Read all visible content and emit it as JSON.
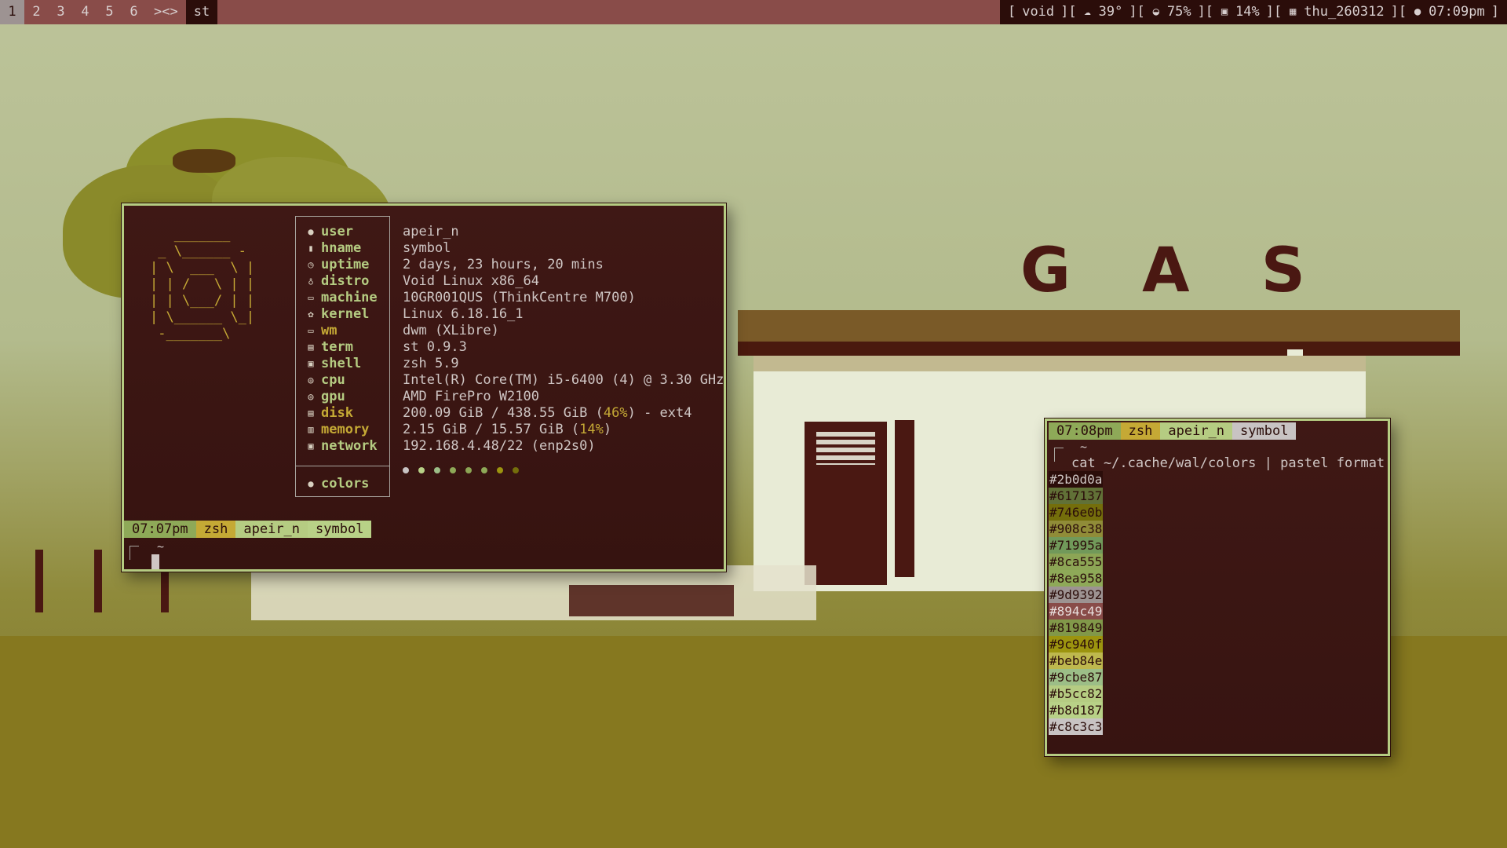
{
  "topbar": {
    "tags": [
      "1",
      "2",
      "3",
      "4",
      "5",
      "6"
    ],
    "active_tag": "1",
    "layout": "><>",
    "window_title": "st",
    "status": {
      "open": "[",
      "host": "void",
      "sep1": "][",
      "temp": "39°",
      "sep2": "][",
      "cpu_or_mem": "75%",
      "sep3": "][",
      "disk": "14%",
      "sep4": "][",
      "date": "thu_260312",
      "sep5": "][",
      "time": "07:09pm",
      "close": "]",
      "icons": [
        "cloud-sun-icon",
        "gauge-icon",
        "save-icon",
        "calendar-icon",
        "clock-icon"
      ]
    }
  },
  "fetch": {
    "logo": "   _______\n _ \\______ -\n| \\  ___  \\ |\n| | /   \\ | |\n| | \\___/ | |\n| \\______ \\_|\n -_______\\",
    "keys": [
      {
        "label": "user",
        "icon": "user-icon"
      },
      {
        "label": "hname",
        "icon": "phone-icon"
      },
      {
        "label": "uptime",
        "icon": "clock-icon"
      },
      {
        "label": "distro",
        "icon": "linux-icon"
      },
      {
        "label": "machine",
        "icon": "laptop-icon"
      },
      {
        "label": "kernel",
        "icon": "gear-icon"
      },
      {
        "label": "wm",
        "icon": "monitor-icon"
      },
      {
        "label": "term",
        "icon": "terminal-icon"
      },
      {
        "label": "shell",
        "icon": "shell-icon"
      },
      {
        "label": "cpu",
        "icon": "chip-icon"
      },
      {
        "label": "gpu",
        "icon": "chip-icon"
      },
      {
        "label": "disk",
        "icon": "disk-icon"
      },
      {
        "label": "memory",
        "icon": "memory-icon"
      },
      {
        "label": "network",
        "icon": "network-icon"
      }
    ],
    "colors_label": "colors",
    "values": {
      "user": "apeir_n",
      "hname": "symbol",
      "uptime": "2 days, 23 hours, 20 mins",
      "distro": "Void Linux x86_64",
      "machine": "10GR001QUS (ThinkCentre M700)",
      "kernel": "Linux 6.18.16_1",
      "wm": "dwm (XLibre)",
      "term": "st 0.9.3",
      "shell": "zsh 5.9",
      "cpu": "Intel(R) Core(TM) i5-6400 (4) @ 3.30 GHz",
      "gpu": "AMD FirePro W2100",
      "disk_a": "200.09 GiB / 438.55 GiB (",
      "disk_pct": "46%",
      "disk_b": ") - ext4",
      "mem_a": "2.15 GiB / 15.57 GiB (",
      "mem_pct": "14%",
      "mem_b": ")",
      "network": "192.168.4.48/22 (enp2s0)"
    },
    "dot_colors": [
      "#c8c3c3",
      "#b8d187",
      "#9cbe87",
      "#8ea958",
      "#8ca555",
      "#8ea958",
      "#9c940f",
      "#746e0b"
    ]
  },
  "prompt1": {
    "time": "07:07pm",
    "shell": "zsh",
    "user": "apeir_n",
    "host": "symbol",
    "dir": "~"
  },
  "prompt2": {
    "time": "07:08pm",
    "shell": "zsh",
    "user": "apeir_n",
    "host": "symbol",
    "dir": "~",
    "command": "cat ~/.cache/wal/colors | pastel format"
  },
  "swatches": [
    {
      "hex": "#2b0d0a",
      "bg": "#2b0d0a",
      "fg": "#cfc6c4"
    },
    {
      "hex": "#617137",
      "bg": "#617137",
      "fg": "#2b0d0a"
    },
    {
      "hex": "#746e0b",
      "bg": "#746e0b",
      "fg": "#2b0d0a"
    },
    {
      "hex": "#908c38",
      "bg": "#908c38",
      "fg": "#2b0d0a"
    },
    {
      "hex": "#71995a",
      "bg": "#71995a",
      "fg": "#2b0d0a"
    },
    {
      "hex": "#8ca555",
      "bg": "#8ca555",
      "fg": "#2b0d0a"
    },
    {
      "hex": "#8ea958",
      "bg": "#8ea958",
      "fg": "#2b0d0a"
    },
    {
      "hex": "#9d9392",
      "bg": "#9d9392",
      "fg": "#2b0d0a"
    },
    {
      "hex": "#894c49",
      "bg": "#894c49",
      "fg": "#e8dedd"
    },
    {
      "hex": "#819849",
      "bg": "#819849",
      "fg": "#2b0d0a"
    },
    {
      "hex": "#9c940f",
      "bg": "#9c940f",
      "fg": "#2b0d0a"
    },
    {
      "hex": "#beb84e",
      "bg": "#beb84e",
      "fg": "#2b0d0a"
    },
    {
      "hex": "#9cbe87",
      "bg": "#9cbe87",
      "fg": "#2b0d0a"
    },
    {
      "hex": "#b5cc82",
      "bg": "#b5cc82",
      "fg": "#2b0d0a"
    },
    {
      "hex": "#b8d187",
      "bg": "#b8d187",
      "fg": "#2b0d0a"
    },
    {
      "hex": "#c8c3c3",
      "bg": "#c8c3c3",
      "fg": "#2b0d0a"
    }
  ],
  "wallpaper": {
    "sign": "G A S"
  }
}
